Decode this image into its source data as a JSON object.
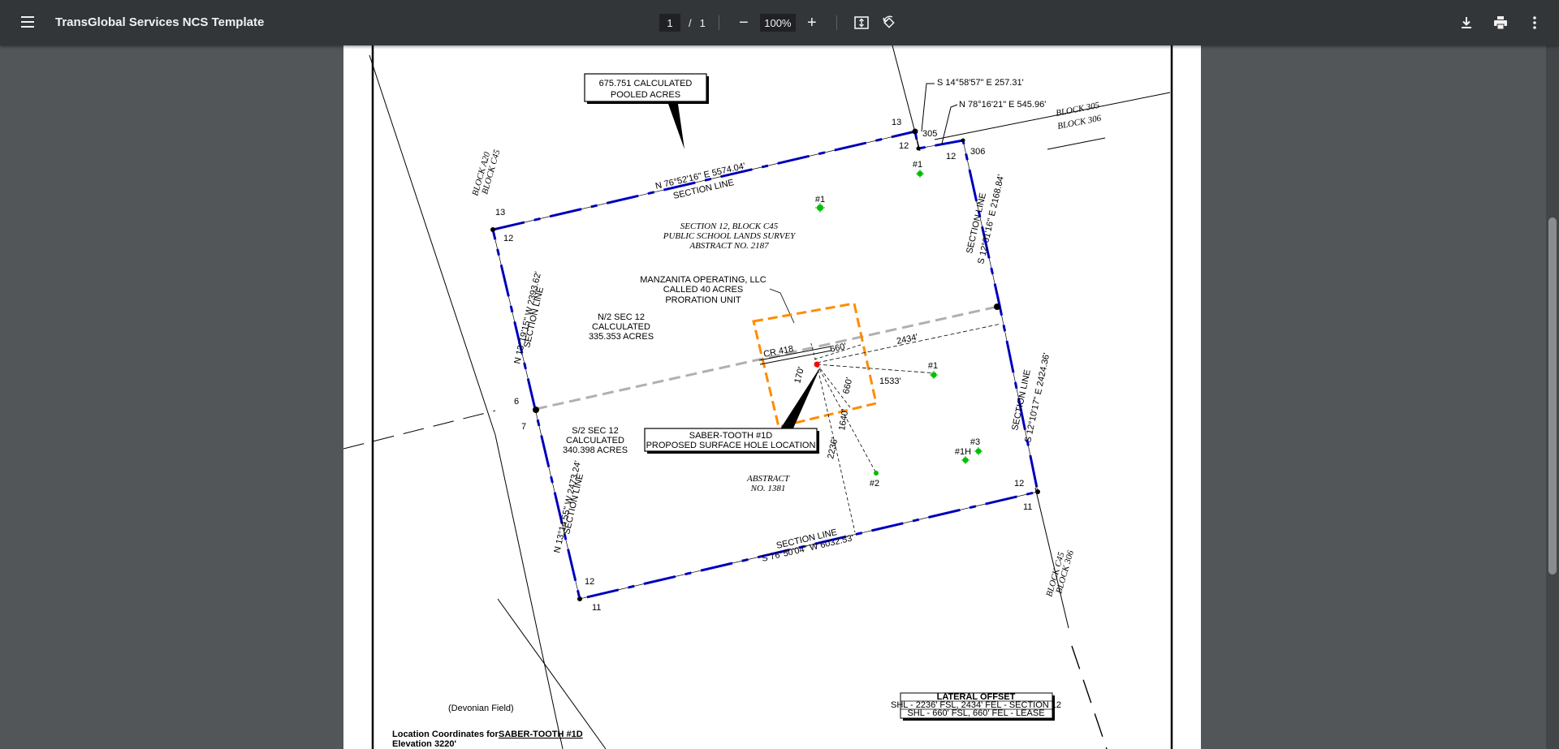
{
  "toolbar": {
    "title": "TransGlobal Services NCS Template",
    "page_current": "1",
    "page_separator": "/",
    "page_total": "1",
    "zoom": "100%",
    "zoom_out": "−",
    "zoom_in": "+"
  },
  "plat": {
    "pooled_label_1": "675.751 CALCULATED",
    "pooled_label_2": "POOLED ACRES",
    "bearing_s14": "S 14°58'57\" E  257.31'",
    "bearing_n78": "N 78°16'21\" E  545.96'",
    "block_305": "BLOCK 305",
    "block_306": "BLOCK 306",
    "block_a20": "BLOCK A20",
    "block_c45": "BLOCK C45",
    "block_c45_b": "BLOCK C45",
    "block_306_b": "BLOCK 306",
    "north_line_bearing": "N 76°52'16\" E  5574.04'",
    "north_line_label": "SECTION LINE",
    "east_line_bearing": "S 12°01'16\" E  2168.84'",
    "east_line_label": "SECTION LINE",
    "east_line_bearing_2": "S 12°10'17\" E  2424.36'",
    "east_line_label_2": "SECTION LINE",
    "west_line_bearing": "N 13°19'15\" W  2393.62'",
    "west_line_label": "SECTION LINE",
    "west_line_bearing_2": "N 13°14'55\" W  2473.24'",
    "west_line_label_2": "SECTION LINE",
    "south_line_label": "SECTION LINE",
    "south_line_bearing": "S 76°50'04\" W  6032.53'",
    "survey_1": "SECTION 12, BLOCK C45",
    "survey_2": "PUBLIC SCHOOL LANDS  SURVEY",
    "survey_3": "ABSTRACT NO. 2187",
    "unit_1": "MANZANITA OPERATING, LLC",
    "unit_2": "CALLED 40 ACRES",
    "unit_3": "PRORATION UNIT",
    "north_half_1": "N/2 SEC 12",
    "north_half_2": "CALCULATED",
    "north_half_3": "335.353 ACRES",
    "south_half_1": "S/2 SEC 12",
    "south_half_2": "CALCULATED",
    "south_half_3": "340.398 ACRES",
    "road": "CR 418",
    "dist_660_h": "660'",
    "dist_2434": "2434'",
    "dist_1533": "1533'",
    "dist_170": "170'",
    "dist_660_v": "660'",
    "dist_1640": "1640'",
    "dist_2236": "2236'",
    "shl_1": "SABER-TOOTH #1D",
    "shl_2": "PROPOSED SURFACE HOLE LOCATION",
    "abstract_1": "ABSTRACT",
    "abstract_2": "NO. 1381",
    "well_1a": "#1",
    "well_1b": "#1",
    "well_1c": "#1",
    "well_2": "#2",
    "well_3": "#3",
    "well_1h": "#1H",
    "corner_13_a": "13",
    "corner_305": "305",
    "corner_12_a": "12",
    "corner_12_b": "12",
    "corner_306": "306",
    "corner_13_b": "13",
    "corner_12_c": "12",
    "corner_6": "6",
    "corner_7": "7",
    "corner_12_d": "12",
    "corner_11_a": "11",
    "corner_12_e": "12",
    "corner_11_b": "11",
    "field": "(Devonian Field)",
    "loc_prefix": "Location Coordinates for ",
    "loc_well": "SABER-TOOTH #1D",
    "elevation": "Elevation 3220'",
    "offset_title": "LATERAL OFFSET",
    "offset_row1": "SHL - 2236' FSL, 2434' FEL - SECTION 12",
    "offset_row2": "SHL - 660' FSL, 660' FEL - LEASE"
  },
  "colors": {
    "toolbar_bg": "#323639",
    "viewer_bg": "#525659",
    "boundary_blue": "#0000ff",
    "unit_orange": "#ff8c00",
    "well_green": "#00c000",
    "shl_red": "#ff0000",
    "centerline_gray": "#b0b0b0"
  },
  "icons": [
    "menu-icon",
    "download-icon",
    "print-icon",
    "more-vert-icon",
    "fit-page-icon",
    "rotate-icon"
  ]
}
